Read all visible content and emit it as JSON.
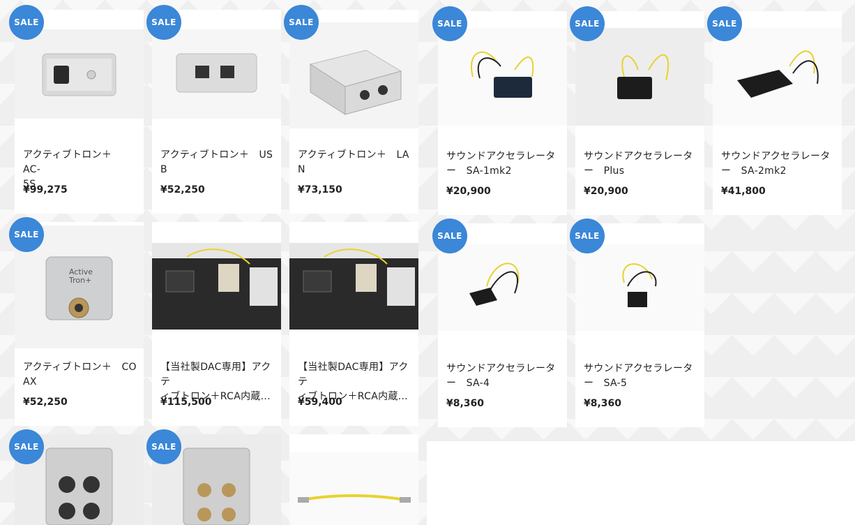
{
  "sale_label": "SALE",
  "products": [
    {
      "name": "アクティブトロン＋　AC-\n5S",
      "price": "¥99,275",
      "sale": true
    },
    {
      "name": "アクティブトロン＋　US\nB",
      "price": "¥52,250",
      "sale": true
    },
    {
      "name": "アクティブトロン＋　LA\nN",
      "price": "¥73,150",
      "sale": true
    },
    {
      "name": "サウンドアクセラレータ\nー　SA-1mk2",
      "price": "¥20,900",
      "sale": true
    },
    {
      "name": "サウンドアクセラレータ\nー　Plus",
      "price": "¥20,900",
      "sale": true
    },
    {
      "name": "サウンドアクセラレータ\nー　SA-2mk2",
      "price": "¥41,800",
      "sale": true
    },
    {
      "name": "アクティブトロン＋　CO\nAX",
      "price": "¥52,250",
      "sale": true
    },
    {
      "name": "【当社製DAC専用】アクテ\nィブトロン＋RCA内蔵...",
      "price": "¥115,500",
      "sale": false
    },
    {
      "name": "【当社製DAC専用】アクテ\nィブトロン＋RCA内蔵...",
      "price": "¥59,400",
      "sale": false
    },
    {
      "name": "サウンドアクセラレータ\nー　SA-4",
      "price": "¥8,360",
      "sale": true
    },
    {
      "name": "サウンドアクセラレータ\nー　SA-5",
      "price": "¥8,360",
      "sale": true
    },
    {
      "name": "",
      "price": "",
      "sale": true
    },
    {
      "name": "",
      "price": "",
      "sale": true
    },
    {
      "name": "",
      "price": "",
      "sale": false
    }
  ],
  "product_logo_text": {
    "line1": "Active",
    "line2": "Tron+"
  },
  "colors": {
    "sale_badge": "#3b87d8",
    "wire_yellow": "#e8d230",
    "device_black": "#1c1c1c"
  }
}
